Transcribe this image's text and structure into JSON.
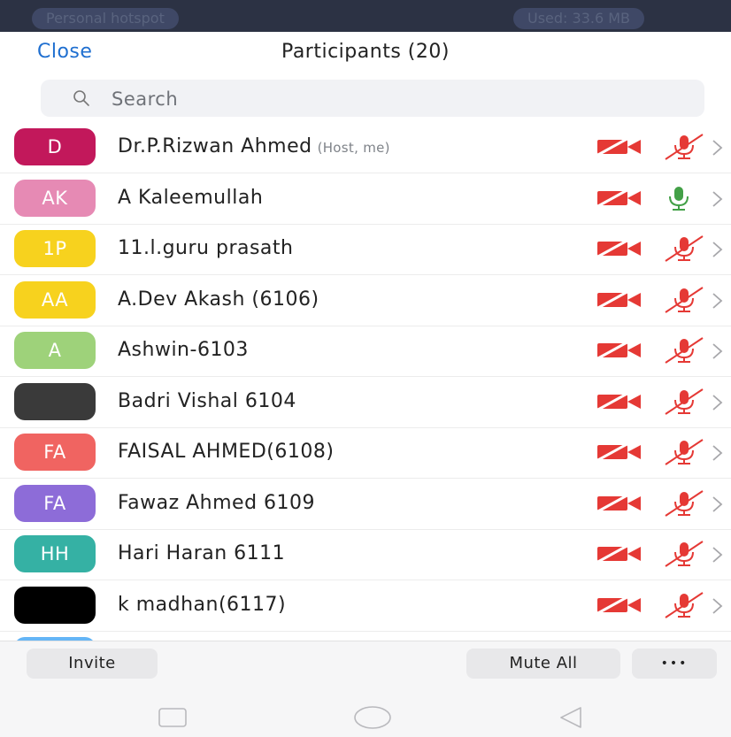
{
  "status_bar": {
    "left_text": "Personal hotspot",
    "right_text": "Used: 33.6 MB"
  },
  "header": {
    "close_label": "Close",
    "title": "Participants (20)"
  },
  "search": {
    "placeholder": "Search"
  },
  "participants": [
    {
      "initials": "D",
      "name": "Dr.P.Rizwan Ahmed",
      "tag": "(Host, me)",
      "avatar_color": "#c2185b",
      "video": "off",
      "audio": "muted"
    },
    {
      "initials": "AK",
      "name": "A Kaleemullah",
      "tag": "",
      "avatar_color": "#e68ab4",
      "video": "off",
      "audio": "unmuted"
    },
    {
      "initials": "1P",
      "name": "11.l.guru prasath",
      "tag": "",
      "avatar_color": "#f7d21e",
      "video": "off",
      "audio": "muted"
    },
    {
      "initials": "AA",
      "name": "A.Dev Akash (6106)",
      "tag": "",
      "avatar_color": "#f7d21e",
      "video": "off",
      "audio": "muted"
    },
    {
      "initials": "A",
      "name": "Ashwin-6103",
      "tag": "",
      "avatar_color": "#9ed27a",
      "video": "off",
      "audio": "muted"
    },
    {
      "initials": "",
      "name": "Badri Vishal 6104",
      "tag": "",
      "avatar_color": "#3a3a3a",
      "video": "off",
      "audio": "muted"
    },
    {
      "initials": "FA",
      "name": "FAISAL AHMED(6108)",
      "tag": "",
      "avatar_color": "#f06461",
      "video": "off",
      "audio": "muted"
    },
    {
      "initials": "FA",
      "name": "Fawaz Ahmed 6109",
      "tag": "",
      "avatar_color": "#8d6cd8",
      "video": "off",
      "audio": "muted"
    },
    {
      "initials": "HH",
      "name": "Hari Haran 6111",
      "tag": "",
      "avatar_color": "#35b1a4",
      "video": "off",
      "audio": "muted"
    },
    {
      "initials": "",
      "name": "k madhan(6117)",
      "tag": "",
      "avatar_color": "#000000",
      "video": "off",
      "audio": "muted"
    }
  ],
  "toolbar": {
    "invite_label": "Invite",
    "mute_all_label": "Mute All",
    "more_label": "•••"
  },
  "colors": {
    "accent": "#1f6fd0",
    "muted_red": "#e53935",
    "unmuted_green": "#43a047"
  }
}
